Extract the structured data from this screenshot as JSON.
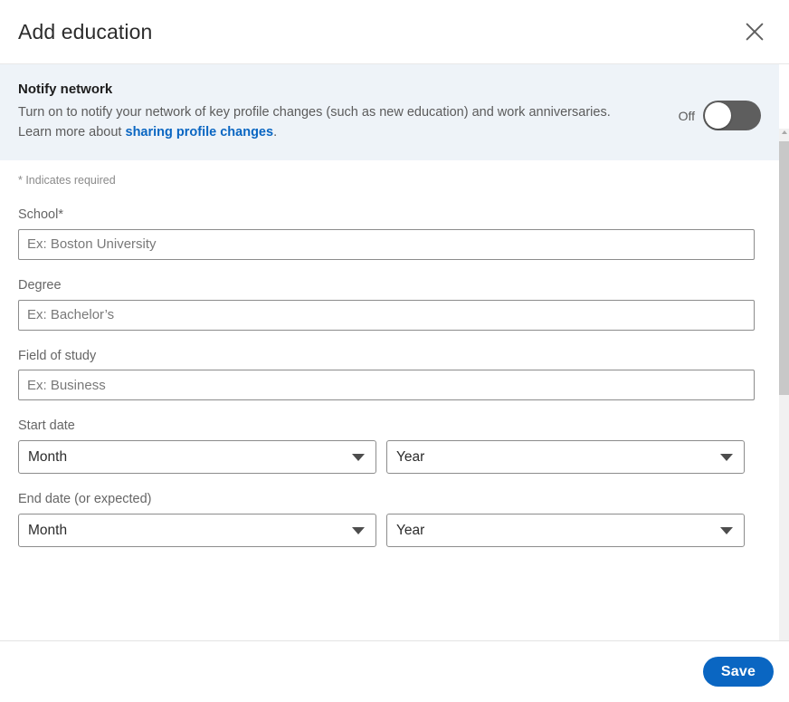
{
  "header": {
    "title": "Add education",
    "close_icon": "close-icon"
  },
  "notify": {
    "title": "Notify network",
    "description_part1": "Turn on to notify your network of key profile changes (such as new education) and work anniversaries. Learn more about ",
    "link_text": "sharing profile changes",
    "description_part2": ".",
    "toggle_state_label": "Off",
    "toggle_on": false,
    "background_color": "#eef3f8",
    "link_color": "#0a66c2"
  },
  "form": {
    "required_note": "* Indicates required",
    "fields": [
      {
        "label": "School*",
        "placeholder": "Ex: Boston University",
        "value": "",
        "type": "text",
        "name": "school"
      },
      {
        "label": "Degree",
        "placeholder": "Ex: Bachelor’s",
        "value": "",
        "type": "text",
        "name": "degree"
      },
      {
        "label": "Field of study",
        "placeholder": "Ex: Business",
        "value": "",
        "type": "text",
        "name": "field-of-study"
      }
    ],
    "start_date": {
      "label": "Start date",
      "month_value": "Month",
      "year_value": "Year"
    },
    "end_date": {
      "label": "End date (or expected)",
      "month_value": "Month",
      "year_value": "Year"
    }
  },
  "footer": {
    "save_label": "Save",
    "save_color": "#0a66c2"
  }
}
